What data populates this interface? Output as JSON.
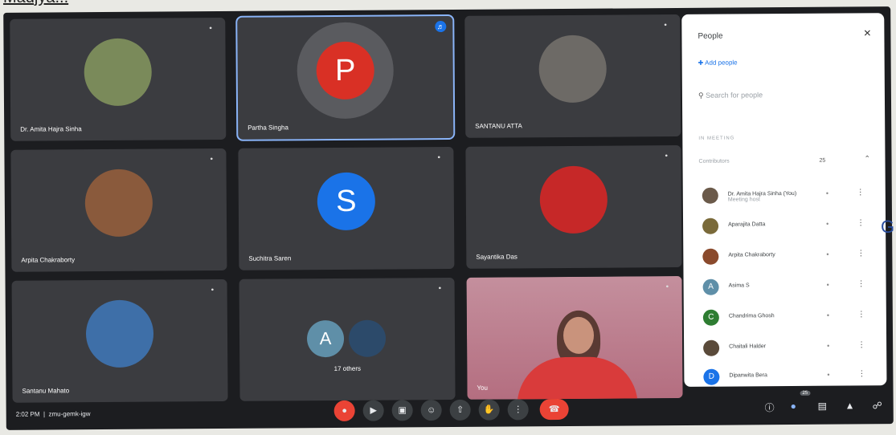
{
  "caption": "Madjya...",
  "tiles": [
    {
      "name": "Dr. Amita Hajra Sinha",
      "kind": "photo",
      "color": "#7a8a5a"
    },
    {
      "name": "Partha Singha",
      "kind": "letter",
      "letter": "P",
      "color": "#d93025",
      "active": true
    },
    {
      "name": "SANTANU ATTA",
      "kind": "photo",
      "color": "#6d6a66"
    },
    {
      "name": "Arpita Chakraborty",
      "kind": "photo",
      "color": "#8a5a3c"
    },
    {
      "name": "Suchitra Saren",
      "kind": "letter",
      "letter": "S",
      "color": "#1a73e8"
    },
    {
      "name": "Sayantika Das",
      "kind": "photo",
      "color": "#c62828"
    },
    {
      "name": "Santanu Mahato",
      "kind": "photo",
      "color": "#3e6fa8"
    },
    {
      "others_label": "17 others",
      "a_letter": "A",
      "a_color": "#5f8fa8"
    },
    {
      "name": "You",
      "kind": "video"
    }
  ],
  "panel": {
    "title": "People",
    "add_people": "Add people",
    "search_placeholder": "Search for people",
    "section_label": "IN MEETING",
    "contributors_label": "Contributors",
    "contributors_count": "25",
    "people": [
      {
        "name": "Dr. Amita Hajra Sinha (You)",
        "sub": "Meeting host",
        "color": "#6b5a4a"
      },
      {
        "name": "Aparajita Datta",
        "color": "#7a6a3a"
      },
      {
        "name": "Arpita Chakraborty",
        "color": "#8a4a2c"
      },
      {
        "name": "Asima S",
        "letter": "A",
        "color": "#5f8fa8"
      },
      {
        "name": "Chandrima Ghosh",
        "letter": "C",
        "color": "#2e7d32"
      },
      {
        "name": "Chaitali Halder",
        "color": "#5a4a3a"
      },
      {
        "name": "Dipanwita Bera",
        "letter": "D",
        "color": "#1a73e8"
      }
    ]
  },
  "bottom": {
    "time": "2:02 PM",
    "meeting_code": "zmu-gemk-igw",
    "participants_badge": "25"
  },
  "icons": {
    "mic": "mic-icon",
    "camera": "camera-icon",
    "captions": "captions-icon",
    "emoji": "emoji-icon",
    "present": "present-icon",
    "hand": "raise-hand-icon",
    "more": "more-icon",
    "end": "end-call-icon"
  }
}
